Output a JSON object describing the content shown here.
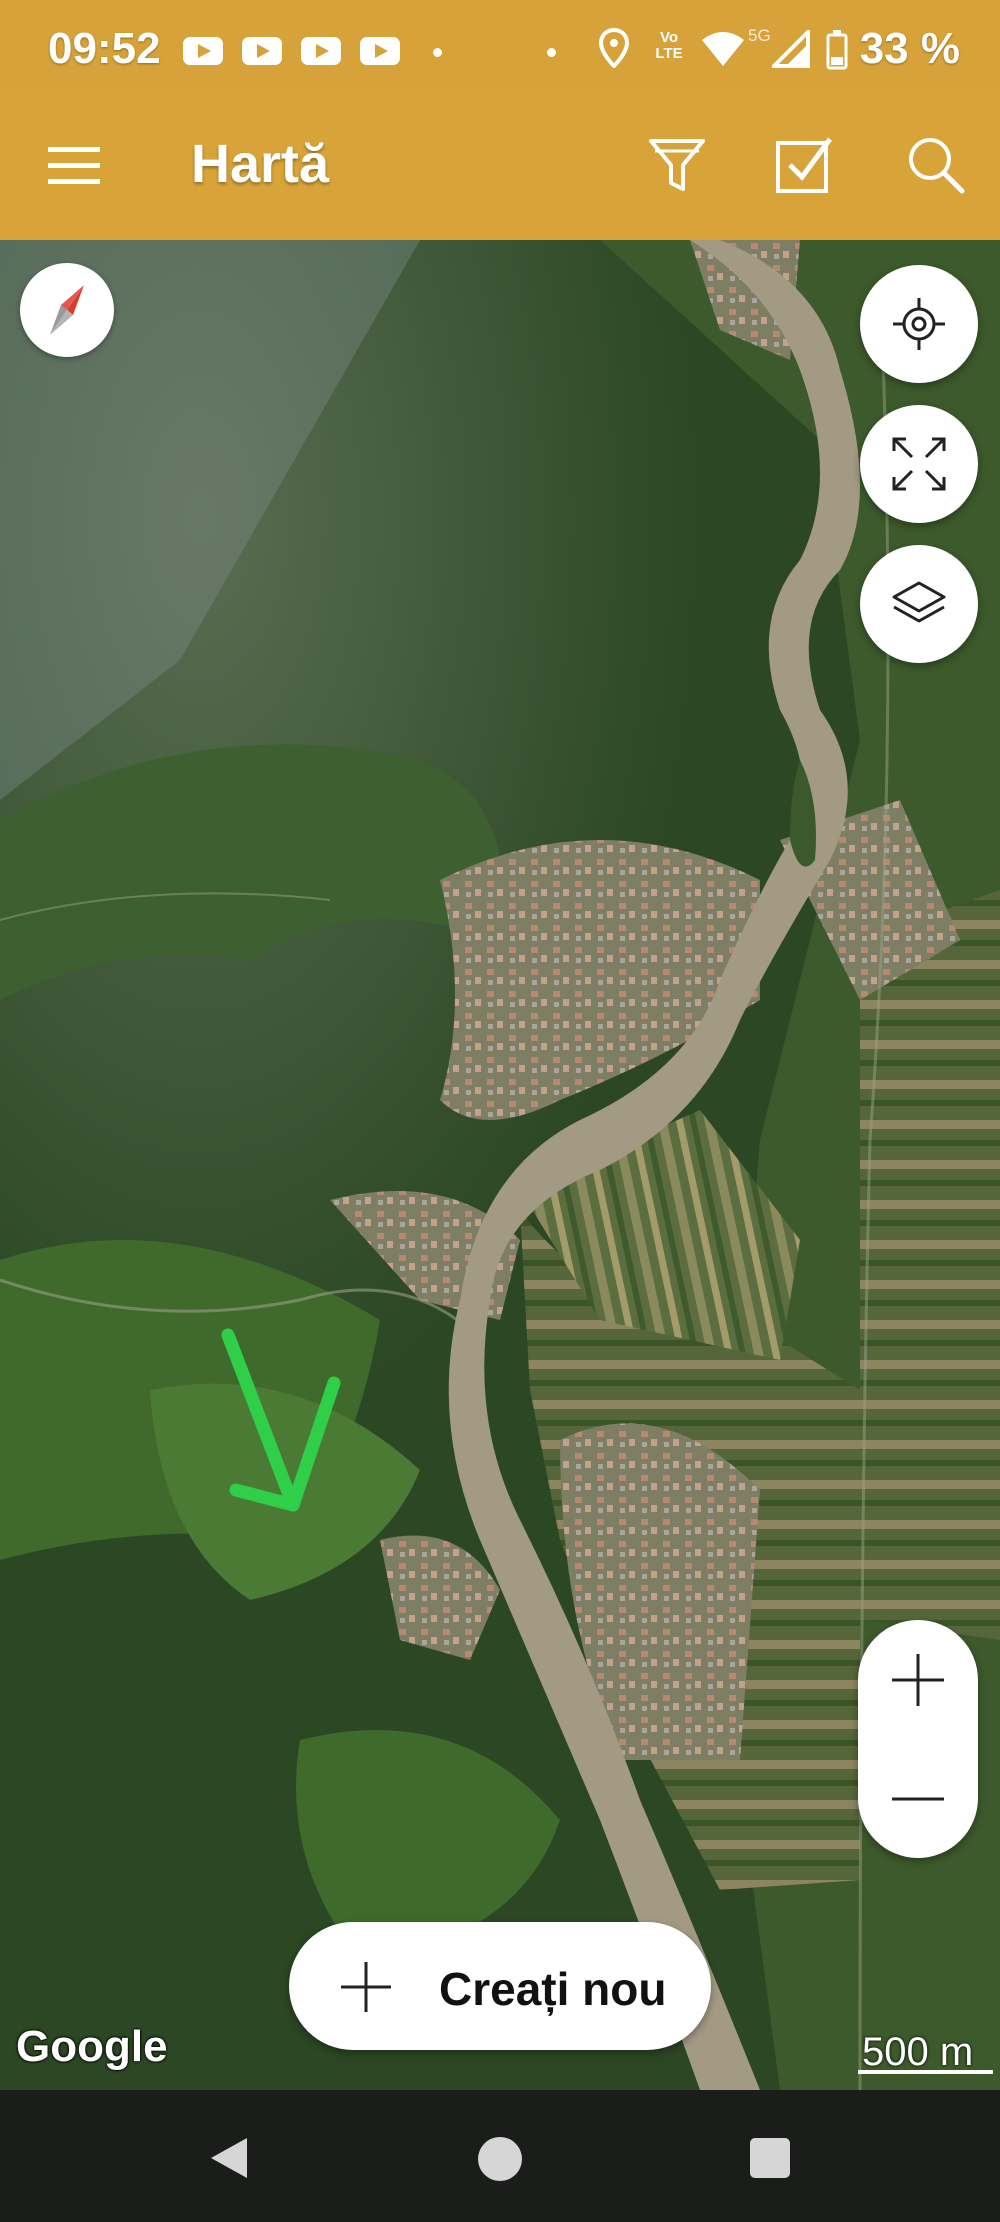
{
  "status_bar": {
    "time": "09:52",
    "battery": "33 %",
    "icons": [
      "youtube-icon",
      "youtube-icon",
      "youtube-icon",
      "youtube-icon",
      "location-icon",
      "volte-icon",
      "wifi-icon",
      "signal-5g-icon",
      "battery-icon"
    ],
    "volte_label": "Vo LTE",
    "network": "5G"
  },
  "app_bar": {
    "title": "Hartă",
    "icons": [
      "menu-icon",
      "filter-icon",
      "checklist-icon",
      "search-icon"
    ]
  },
  "map": {
    "attribution": "Google",
    "scale_label": "500 m",
    "controls": [
      "compass-icon",
      "my-location-icon",
      "fullscreen-icon",
      "layers-icon",
      "zoom-in-icon",
      "zoom-out-icon"
    ],
    "create_button_label": "Creați nou",
    "annotation_color": "#2fcf4a",
    "river_color": "#a39a84"
  },
  "nav_bar": {
    "icons": [
      "back-icon",
      "home-icon",
      "recents-icon"
    ]
  },
  "colors": {
    "accent": "#d8a43a",
    "forest": "#2d4a24"
  }
}
